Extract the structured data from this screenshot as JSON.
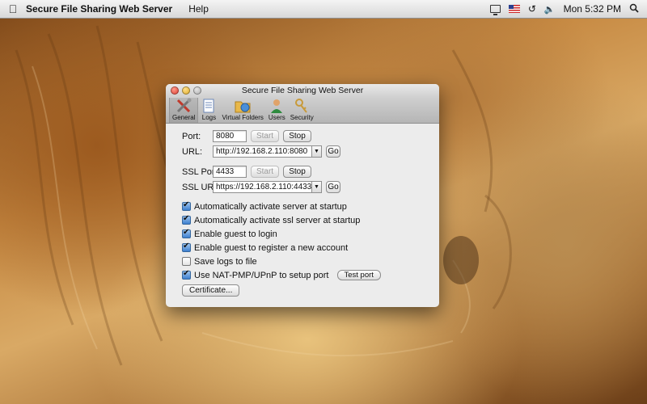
{
  "menubar": {
    "app_name": "Secure File Sharing Web Server",
    "menus": [
      "Help"
    ],
    "clock": "Mon 5:32 PM",
    "icons": [
      "apple-icon",
      "display-icon",
      "flag-icon",
      "time-machine-icon",
      "volume-icon",
      "spotlight-icon"
    ]
  },
  "window": {
    "title": "Secure File Sharing Web Server",
    "toolbar": [
      {
        "label": "General",
        "icon": "tools-icon",
        "selected": true
      },
      {
        "label": "Logs",
        "icon": "logs-icon",
        "selected": false
      },
      {
        "label": "Virtual Folders",
        "icon": "folder-globe-icon",
        "selected": false
      },
      {
        "label": "Users",
        "icon": "users-icon",
        "selected": false
      },
      {
        "label": "Security",
        "icon": "keys-icon",
        "selected": false
      }
    ],
    "general": {
      "port_label": "Port:",
      "port_value": "8080",
      "start_label": "Start",
      "stop_label": "Stop",
      "url_label": "URL:",
      "url_value": "http://192.168.2.110:8080",
      "go_label": "Go",
      "ssl_port_label": "SSL Port:",
      "ssl_port_value": "4433",
      "ssl_start_label": "Start",
      "ssl_stop_label": "Stop",
      "ssl_url_label": "SSL URL:",
      "ssl_url_value": "https://192.168.2.110:4433",
      "ssl_go_label": "Go",
      "options": [
        {
          "label": "Automatically activate server at startup",
          "checked": true
        },
        {
          "label": "Automatically activate ssl server at startup",
          "checked": true
        },
        {
          "label": "Enable guest to login",
          "checked": true
        },
        {
          "label": "Enable guest to register a new account",
          "checked": true
        },
        {
          "label": "Save logs to file",
          "checked": false
        },
        {
          "label": "Use NAT-PMP/UPnP to setup port",
          "checked": true
        }
      ],
      "test_port_label": "Test port",
      "certificate_label": "Certificate..."
    }
  }
}
